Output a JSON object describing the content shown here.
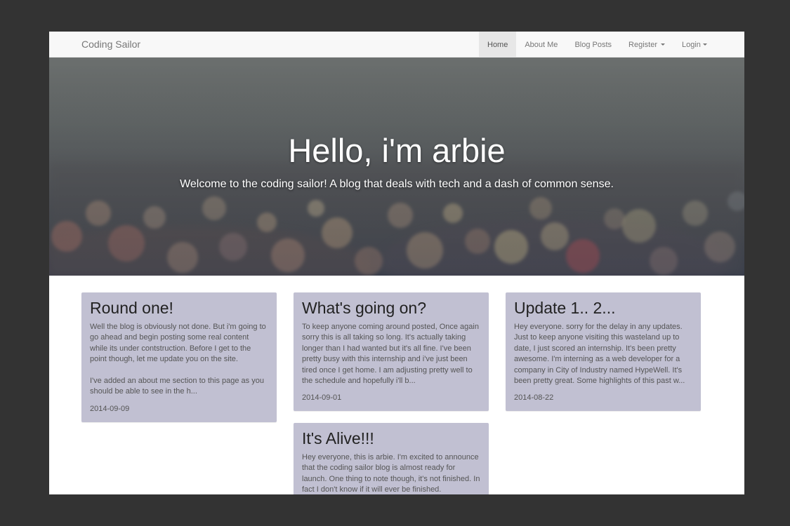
{
  "navbar": {
    "brand": "Coding Sailor",
    "items": [
      {
        "label": "Home",
        "active": true,
        "dropdown": false
      },
      {
        "label": "About Me",
        "active": false,
        "dropdown": false
      },
      {
        "label": "Blog Posts",
        "active": false,
        "dropdown": false
      },
      {
        "label": "Register",
        "active": false,
        "dropdown": true
      },
      {
        "label": "Login",
        "active": false,
        "dropdown": true
      }
    ]
  },
  "hero": {
    "title": "Hello, i'm arbie",
    "subtitle": "Welcome to the coding sailor! A blog that deals with tech and a dash of common sense."
  },
  "posts": [
    {
      "title": "Round one!",
      "excerpt_1": "Well the blog is obviously not done. But i'm going to go ahead and begin posting some real content while its under contstruction. Before I get to the point though, let me update you on the site.",
      "excerpt_2": "I've added an about me section to this page as you should be able to see in the h...",
      "date": "2014-09-09"
    },
    {
      "title": "What's going on?",
      "excerpt_1": "To keep anyone coming around posted, Once again sorry this is all taking so long. It's actually taking longer than I had wanted but it's all fine. I've been pretty busy with this internship and i've just been tired once I get home. I am adjusting pretty well to the schedule and hopefully i'll b...",
      "date": "2014-09-01"
    },
    {
      "title": "Update 1.. 2...",
      "excerpt_1": "Hey everyone. sorry for the delay in any updates. Just to keep anyone visiting this wasteland up to date, I just scored an internship. It's been pretty awesome. I'm interning as a web developer for a company in City of Industry named HypeWell. It's been pretty great. Some highlights of this past w...",
      "date": "2014-08-22"
    },
    {
      "title": "It's Alive!!!",
      "excerpt_1": "Hey everyone, this is arbie. I'm excited to announce that the coding sailor blog is almost ready for launch. One thing to note though, it's not finished. In fact I don't know if it will ever be finished."
    }
  ],
  "colors": {
    "page_background": "#333333",
    "navbar_background": "#f8f8f8",
    "active_nav_background": "#e7e7e7",
    "card_background": "#c1c0d2"
  }
}
